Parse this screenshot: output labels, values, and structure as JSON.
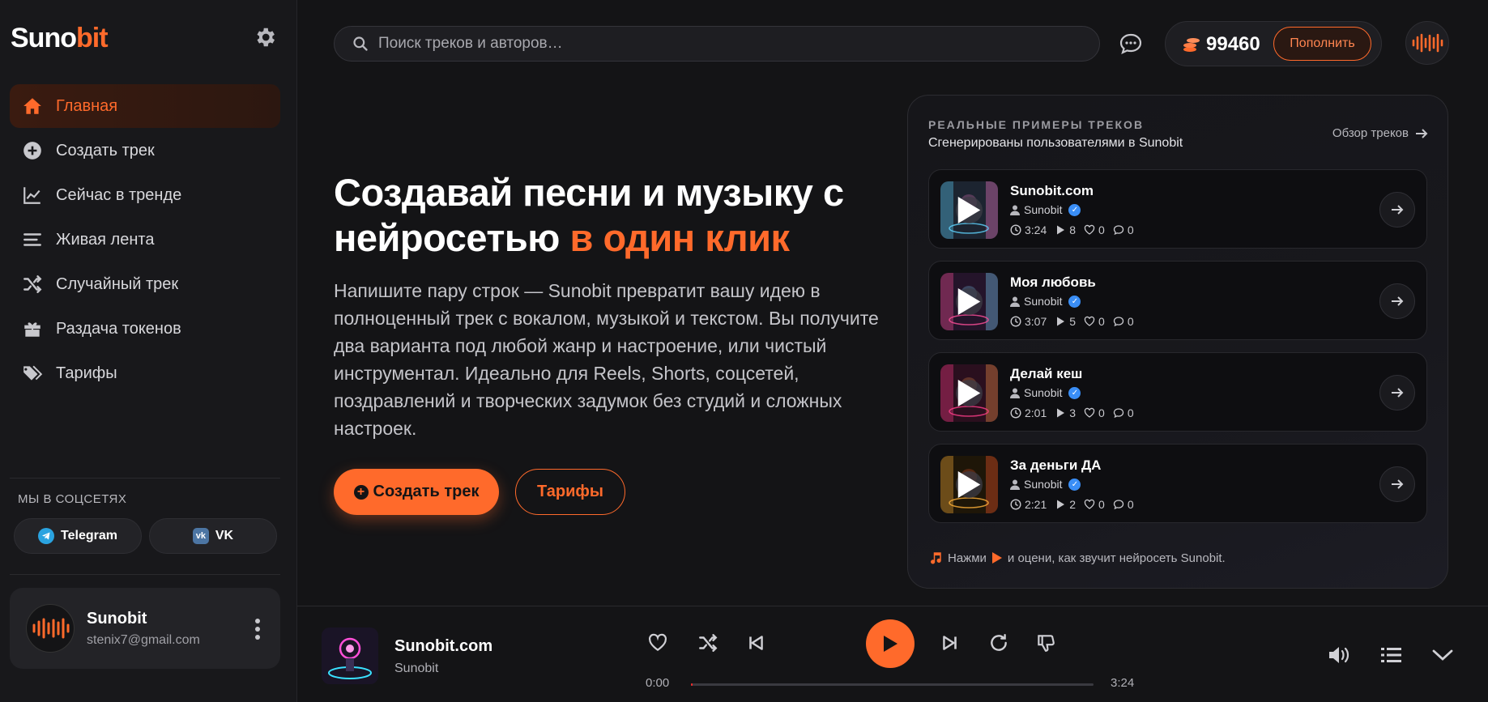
{
  "brand": {
    "part1": "Suno",
    "part2": "bit"
  },
  "nav": [
    {
      "label": "Главная",
      "icon": "home-icon",
      "active": true
    },
    {
      "label": "Создать трек",
      "icon": "plus-circle-icon"
    },
    {
      "label": "Сейчас в тренде",
      "icon": "trend-chart-icon"
    },
    {
      "label": "Живая лента",
      "icon": "feed-lines-icon"
    },
    {
      "label": "Случайный трек",
      "icon": "shuffle-icon"
    },
    {
      "label": "Раздача токенов",
      "icon": "gift-icon"
    },
    {
      "label": "Тарифы",
      "icon": "tags-icon"
    }
  ],
  "social": {
    "title": "МЫ В СОЦСЕТЯХ",
    "telegram": "Telegram",
    "vk": "VK",
    "vk_icon_text": "vk"
  },
  "user": {
    "name": "Sunobit",
    "email": "stenix7@gmail.com"
  },
  "search": {
    "placeholder": "Поиск треков и авторов…"
  },
  "balance": {
    "value": "99460",
    "topup_label": "Пополнить"
  },
  "hero": {
    "title_part1": "Создавай песни и музыку с нейросетью ",
    "title_highlight": "в один клик",
    "description": "Напишите пару строк — Sunobit превратит вашу идею в полноценный трек с вокалом, музыкой и текстом. Вы получите два варианта под любой жанр и настроение, или чистый инструментал. Идеально для Reels, Shorts, соцсетей, поздравлений и творческих задумок без студий и сложных настроек.",
    "primary_button": "Создать трек",
    "secondary_button": "Тарифы"
  },
  "panel": {
    "kicker": "РЕАЛЬНЫЕ ПРИМЕРЫ ТРЕКОВ",
    "subtitle": "Сгенерированы пользователями в Sunobit",
    "link_label": "Обзор треков",
    "hint_part1": "Нажми",
    "hint_part2": "и оцени, как звучит нейросеть Sunobit.",
    "tracks": [
      {
        "title": "Sunobit.com",
        "author": "Sunobit",
        "duration": "3:24",
        "plays": "8",
        "likes": "0",
        "comments": "0"
      },
      {
        "title": "Моя любовь",
        "author": "Sunobit",
        "duration": "3:07",
        "plays": "5",
        "likes": "0",
        "comments": "0"
      },
      {
        "title": "Делай кеш",
        "author": "Sunobit",
        "duration": "2:01",
        "plays": "3",
        "likes": "0",
        "comments": "0"
      },
      {
        "title": "За деньги ДА",
        "author": "Sunobit",
        "duration": "2:21",
        "plays": "2",
        "likes": "0",
        "comments": "0"
      }
    ]
  },
  "player": {
    "title": "Sunobit.com",
    "artist": "Sunobit",
    "time_current": "0:00",
    "time_total": "3:24",
    "progress_fraction": 0.004
  },
  "colors": {
    "accent": "#ff6a2b",
    "verified": "#3a8ef6",
    "telegram": "#2aa3e0",
    "vk": "#4c75a3"
  }
}
